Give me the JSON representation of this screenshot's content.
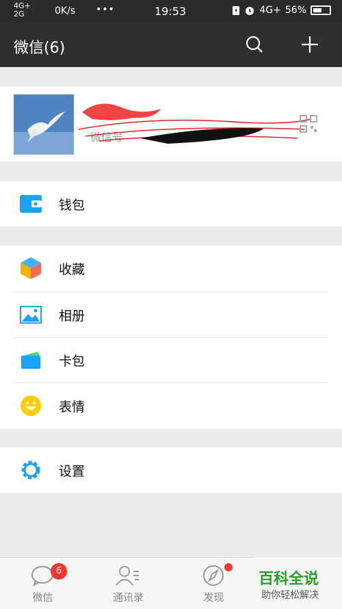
{
  "status_bar": {
    "network_top": "4G+",
    "network_bottom": "2G",
    "speed": "0K/s",
    "more": "•••",
    "time": "19:53",
    "network_right": "4G+",
    "battery": "56%",
    "battery_level": 0.56
  },
  "header": {
    "title": "微信(6)"
  },
  "profile": {
    "wxid_label": "微信号"
  },
  "menu": {
    "wallet": "钱包",
    "favorites": "收藏",
    "album": "相册",
    "cards": "卡包",
    "stickers": "表情",
    "settings": "设置"
  },
  "tabs": {
    "chats": "微信",
    "chats_badge": "6",
    "contacts": "通讯录",
    "discover": "发现"
  },
  "watermark": {
    "title": "百科全说",
    "subtitle": "助你轻松解决"
  },
  "colors": {
    "accent_green": "#2c9d2c",
    "badge_red": "#f43530",
    "wallet_blue": "#1aa3f5"
  }
}
